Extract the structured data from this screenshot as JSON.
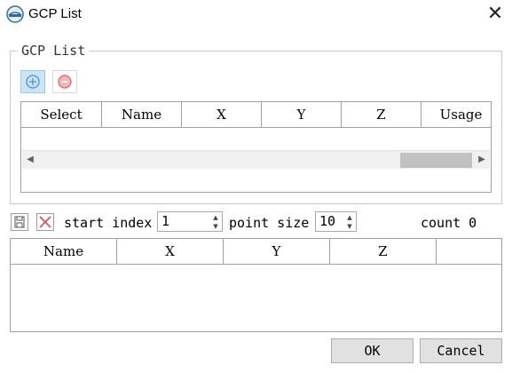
{
  "window": {
    "title": "GCP List",
    "icon": "lidar-app-logo-icon",
    "close_icon": "close-icon"
  },
  "gcp_group": {
    "legend": "GCP List",
    "add_icon": "add-icon",
    "remove_icon": "remove-icon",
    "table": {
      "columns": [
        "Select",
        "Name",
        "X",
        "Y",
        "Z",
        "Usage"
      ],
      "rows": []
    },
    "scroll_left_icon": "scroll-left-icon",
    "scroll_right_icon": "scroll-right-icon"
  },
  "point_toolbar": {
    "save_icon": "save-icon",
    "delete_icon": "delete-icon",
    "start_index_label": "start index",
    "start_index_value": "1",
    "point_size_label": "point size",
    "point_size_value": "10",
    "count_label": "count 0"
  },
  "points_table": {
    "columns": [
      "Name",
      "X",
      "Y",
      "Z",
      ""
    ],
    "rows": []
  },
  "buttons": {
    "ok": "OK",
    "cancel": "Cancel"
  },
  "colors": {
    "add_accent": "#4a90d9",
    "remove_accent": "#e06060",
    "active_button_bg": "#cce4f7"
  }
}
